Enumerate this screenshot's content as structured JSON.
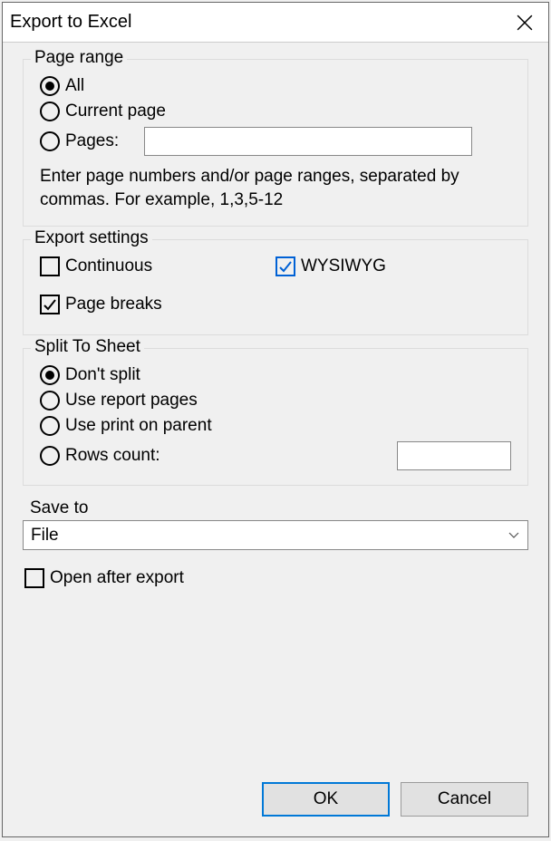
{
  "dialog": {
    "title": "Export to Excel"
  },
  "pageRange": {
    "legend": "Page range",
    "all": "All",
    "currentPage": "Current page",
    "pagesLabel": "Pages:",
    "pagesValue": "",
    "hint": "Enter page numbers and/or page ranges, separated by commas. For example, 1,3,5-12",
    "selected": "all"
  },
  "exportSettings": {
    "legend": "Export settings",
    "continuous": "Continuous",
    "wysiwyg": "WYSIWYG",
    "pageBreaks": "Page breaks",
    "continuousChecked": false,
    "wysiwygChecked": true,
    "pageBreaksChecked": true
  },
  "splitToSheet": {
    "legend": "Split To Sheet",
    "dontSplit": "Don't split",
    "useReportPages": "Use report pages",
    "usePrintOnParent": "Use print on parent",
    "rowsCountLabel": "Rows count:",
    "rowsCountValue": "",
    "selected": "dontSplit"
  },
  "saveTo": {
    "label": "Save to",
    "value": "File"
  },
  "openAfter": {
    "label": "Open after export",
    "checked": false
  },
  "buttons": {
    "ok": "OK",
    "cancel": "Cancel"
  }
}
